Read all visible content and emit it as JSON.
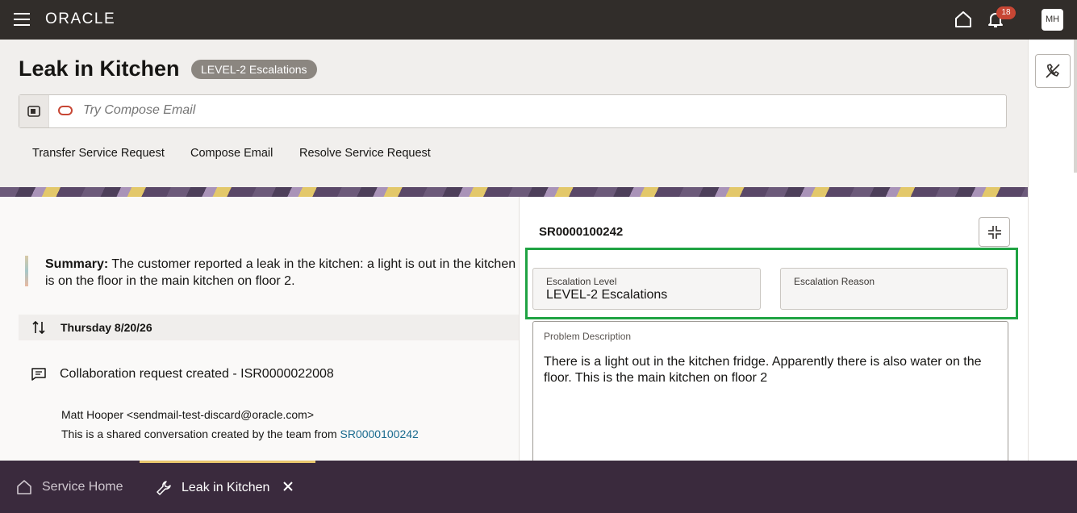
{
  "topbar": {
    "logo": "ORACLE",
    "notification_count": "18",
    "avatar_initials": "MH"
  },
  "header": {
    "title": "Leak in Kitchen",
    "badge": "LEVEL-2 Escalations",
    "compose_placeholder": "Try Compose Email",
    "actions": [
      "Transfer Service Request",
      "Compose Email",
      "Resolve Service Request"
    ]
  },
  "summary": {
    "label": "Summary:",
    "text_line1": " The customer reported a leak in the kitchen: a light is out in the kitchen",
    "text_line2": "is on the floor in the main kitchen on floor 2."
  },
  "timeline": {
    "date": "Thursday 8/20/26",
    "entry_title": "Collaboration request created - ISR0000022008",
    "from_line": "Matt Hooper <sendmail-test-discard@oracle.com>",
    "conversation_text": "This is a shared conversation created by the team from ",
    "conversation_link": "SR0000100242"
  },
  "panel": {
    "sr_number": "SR0000100242",
    "escalation_level_label": "Escalation Level",
    "escalation_level_value": "LEVEL-2 Escalations",
    "escalation_reason_label": "Escalation Reason",
    "escalation_reason_value": "",
    "problem_label": "Problem Description",
    "problem_text": "There is a light out in the kitchen fridge. Apparently there is also water on the floor. This is the main kitchen on floor 2"
  },
  "bottom_nav": {
    "tabs": [
      {
        "label": "Service Home",
        "icon": "home-icon"
      },
      {
        "label": "Leak in Kitchen",
        "icon": "wrench-icon"
      }
    ]
  },
  "colors": {
    "topbar": "#312d2a",
    "badge_red": "#c74634",
    "highlight_green": "#1fa343",
    "bottom_nav": "#3a2a3d",
    "active_tab_accent": "#e8c66d",
    "link": "#1a6b8f"
  }
}
